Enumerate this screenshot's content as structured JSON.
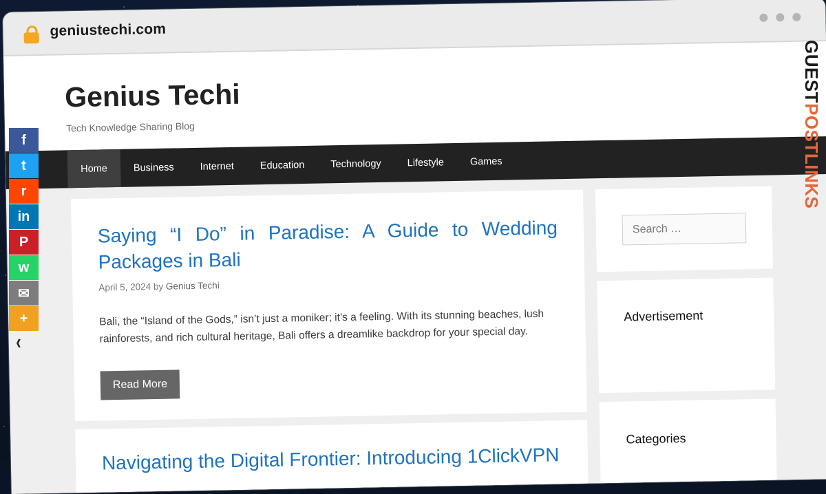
{
  "browser": {
    "url": "geniustechi.com"
  },
  "site": {
    "title": "Genius Techi",
    "tagline": "Tech Knowledge Sharing Blog"
  },
  "nav": {
    "items": [
      {
        "label": "Home",
        "active": true
      },
      {
        "label": "Business"
      },
      {
        "label": "Internet"
      },
      {
        "label": "Education"
      },
      {
        "label": "Technology"
      },
      {
        "label": "Lifestyle"
      },
      {
        "label": "Games"
      }
    ]
  },
  "posts": [
    {
      "title": "Saying “I Do” in Paradise: A Guide to Wedding Packages in Bali",
      "date": "April 5, 2024",
      "by": "by",
      "author": "Genius Techi",
      "excerpt": "Bali, the “Island of the Gods,” isn’t just a moniker; it’s a feeling. With its stunning beaches, lush rainforests, and rich cultural heritage, Bali offers a dreamlike backdrop for your special day.",
      "read_more": "Read More"
    },
    {
      "title": "Navigating the Digital Frontier: Introducing 1ClickVPN"
    }
  ],
  "sidebar": {
    "search_placeholder": "Search …",
    "advertisement_title": "Advertisement",
    "categories_title": "Categories"
  },
  "share": [
    {
      "name": "facebook",
      "glyph": "f",
      "color": "#3b5998"
    },
    {
      "name": "twitter",
      "glyph": "t",
      "color": "#1da1f2"
    },
    {
      "name": "reddit",
      "glyph": "r",
      "color": "#ff4500"
    },
    {
      "name": "linkedin",
      "glyph": "in",
      "color": "#0077b5"
    },
    {
      "name": "pinterest",
      "glyph": "P",
      "color": "#cb2027"
    },
    {
      "name": "whatsapp",
      "glyph": "w",
      "color": "#25d366"
    },
    {
      "name": "email",
      "glyph": "✉",
      "color": "#7d7d7d"
    },
    {
      "name": "more",
      "glyph": "+",
      "color": "#f0a11d"
    }
  ],
  "watermark": {
    "part1": "GUEST",
    "part2": "POSTLINKS"
  }
}
